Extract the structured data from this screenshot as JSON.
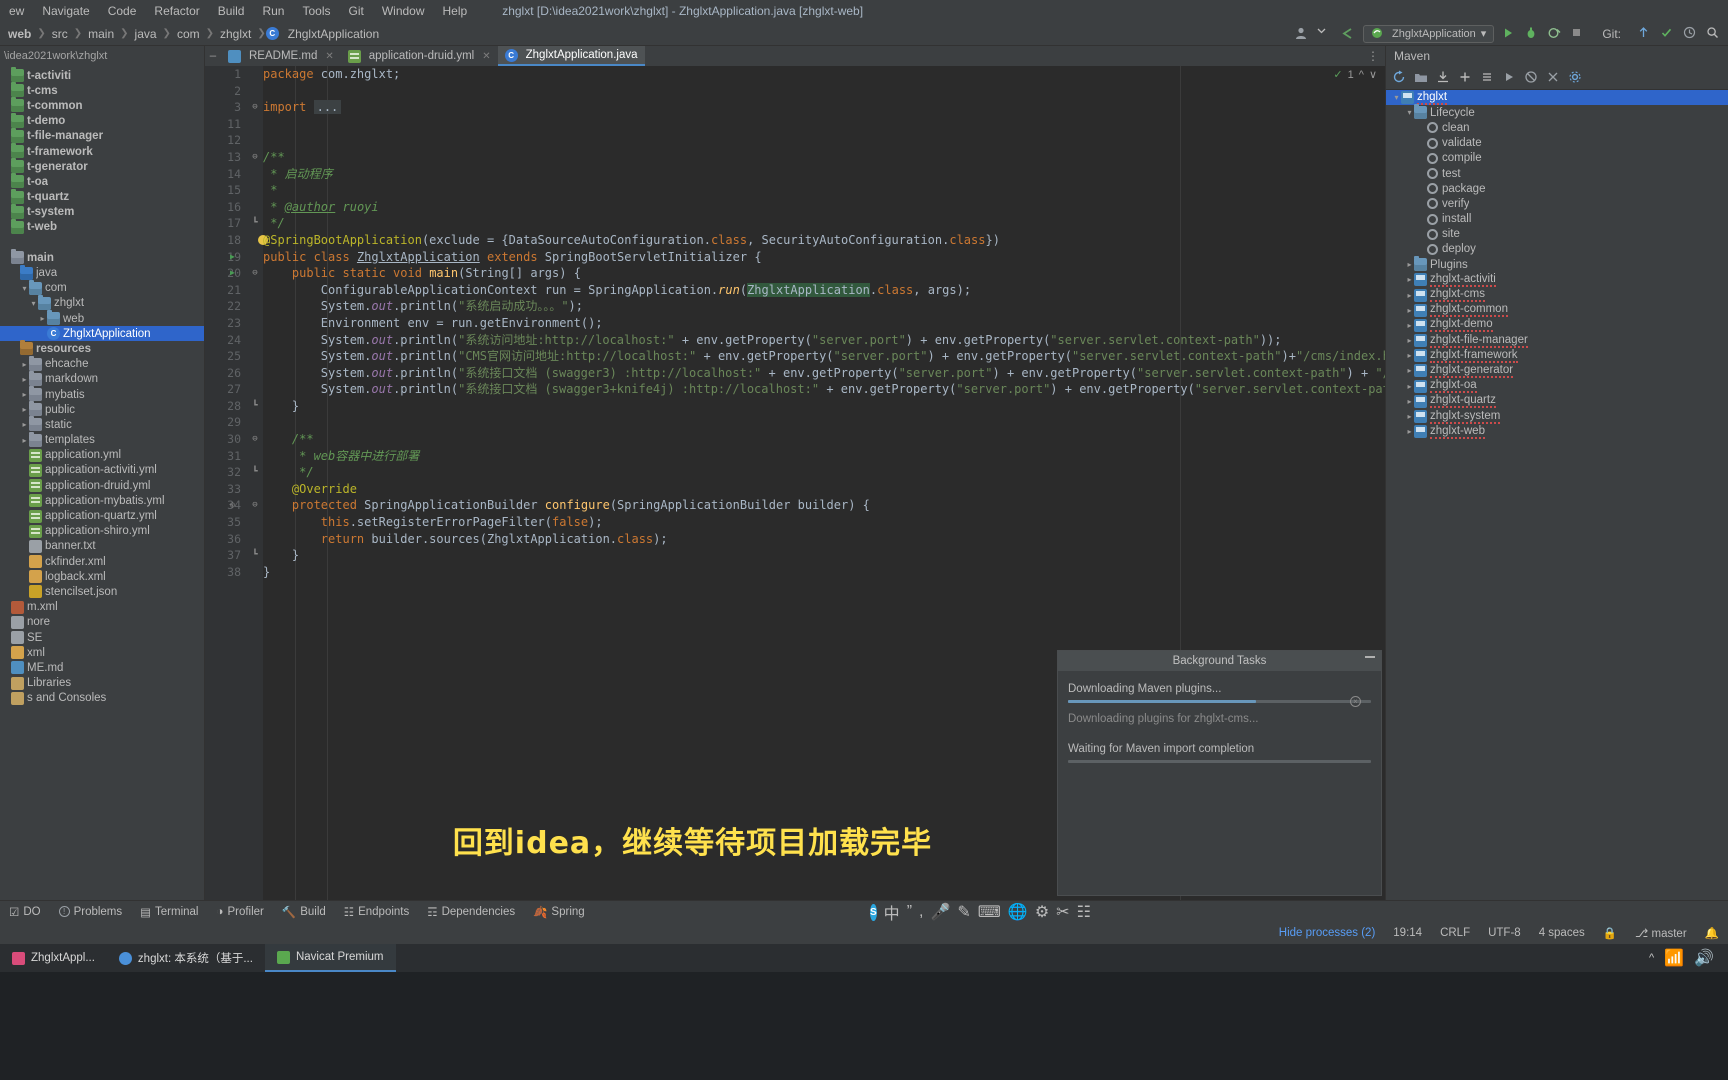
{
  "window": {
    "title": "zhglxt [D:\\idea2021work\\zhglxt] - ZhglxtApplication.java [zhglxt-web]",
    "menu": [
      "ew",
      "Navigate",
      "Code",
      "Refactor",
      "Build",
      "Run",
      "Tools",
      "Git",
      "Window",
      "Help"
    ]
  },
  "navbar": {
    "crumbs": [
      "web",
      "src",
      "main",
      "java",
      "com",
      "zhglxt",
      "ZhglxtApplication"
    ],
    "run_config": "ZhglxtApplication",
    "icons": [
      "user-avatar-icon",
      "chevron-down-icon",
      "back-arrow-icon",
      "run-icon",
      "debug-icon",
      "run-with-coverage-icon",
      "stop-icon",
      "search-icon"
    ],
    "git_label": "Git:"
  },
  "project_panel": {
    "header": "\\idea2021work\\zhglxt",
    "items": [
      {
        "label": "t-activiti",
        "indent": 0,
        "icon": "module-icon",
        "bold": true,
        "arrow": ""
      },
      {
        "label": "t-cms",
        "indent": 0,
        "icon": "module-icon",
        "bold": true,
        "arrow": ""
      },
      {
        "label": "t-common",
        "indent": 0,
        "icon": "module-icon",
        "bold": true,
        "arrow": ""
      },
      {
        "label": "t-demo",
        "indent": 0,
        "icon": "module-icon",
        "bold": true,
        "arrow": ""
      },
      {
        "label": "t-file-manager",
        "indent": 0,
        "icon": "module-icon",
        "bold": true,
        "arrow": ""
      },
      {
        "label": "t-framework",
        "indent": 0,
        "icon": "module-icon",
        "bold": true,
        "arrow": ""
      },
      {
        "label": "t-generator",
        "indent": 0,
        "icon": "module-icon",
        "bold": true,
        "arrow": ""
      },
      {
        "label": "t-oa",
        "indent": 0,
        "icon": "module-icon",
        "bold": true,
        "arrow": ""
      },
      {
        "label": "t-quartz",
        "indent": 0,
        "icon": "module-icon",
        "bold": true,
        "arrow": ""
      },
      {
        "label": "t-system",
        "indent": 0,
        "icon": "module-icon",
        "bold": true,
        "arrow": ""
      },
      {
        "label": "t-web",
        "indent": 0,
        "icon": "module-icon",
        "bold": true,
        "arrow": ""
      },
      {
        "label": "",
        "indent": 0,
        "icon": "spacer",
        "bold": false,
        "arrow": ""
      },
      {
        "label": "main",
        "indent": 0,
        "icon": "folder-icon",
        "bold": true,
        "arrow": ""
      },
      {
        "label": "java",
        "indent": 1,
        "icon": "source-folder-icon",
        "bold": false,
        "arrow": ""
      },
      {
        "label": "com",
        "indent": 2,
        "icon": "package-folder-icon",
        "bold": false,
        "arrow": "v"
      },
      {
        "label": "zhglxt",
        "indent": 3,
        "icon": "package-folder-icon",
        "bold": false,
        "arrow": "v"
      },
      {
        "label": "web",
        "indent": 4,
        "icon": "package-folder-icon",
        "bold": false,
        "arrow": ">"
      },
      {
        "label": "ZhglxtApplication",
        "indent": 4,
        "icon": "java-class-icon",
        "bold": false,
        "arrow": "",
        "selected": true
      },
      {
        "label": "resources",
        "indent": 1,
        "icon": "resource-folder-icon",
        "bold": true,
        "arrow": ""
      },
      {
        "label": "ehcache",
        "indent": 2,
        "icon": "folder-icon",
        "bold": false,
        "arrow": ">"
      },
      {
        "label": "markdown",
        "indent": 2,
        "icon": "folder-icon",
        "bold": false,
        "arrow": ">"
      },
      {
        "label": "mybatis",
        "indent": 2,
        "icon": "folder-icon",
        "bold": false,
        "arrow": ">"
      },
      {
        "label": "public",
        "indent": 2,
        "icon": "folder-icon",
        "bold": false,
        "arrow": ">"
      },
      {
        "label": "static",
        "indent": 2,
        "icon": "folder-icon",
        "bold": false,
        "arrow": ">"
      },
      {
        "label": "templates",
        "indent": 2,
        "icon": "folder-icon",
        "bold": false,
        "arrow": ">"
      },
      {
        "label": "application.yml",
        "indent": 2,
        "icon": "yml-file-icon",
        "bold": false,
        "arrow": ""
      },
      {
        "label": "application-activiti.yml",
        "indent": 2,
        "icon": "yml-file-icon",
        "bold": false,
        "arrow": ""
      },
      {
        "label": "application-druid.yml",
        "indent": 2,
        "icon": "yml-file-icon",
        "bold": false,
        "arrow": ""
      },
      {
        "label": "application-mybatis.yml",
        "indent": 2,
        "icon": "yml-file-icon",
        "bold": false,
        "arrow": ""
      },
      {
        "label": "application-quartz.yml",
        "indent": 2,
        "icon": "yml-file-icon",
        "bold": false,
        "arrow": ""
      },
      {
        "label": "application-shiro.yml",
        "indent": 2,
        "icon": "yml-file-icon",
        "bold": false,
        "arrow": ""
      },
      {
        "label": "banner.txt",
        "indent": 2,
        "icon": "txt-file-icon",
        "bold": false,
        "arrow": ""
      },
      {
        "label": "ckfinder.xml",
        "indent": 2,
        "icon": "xml-file-icon",
        "bold": false,
        "arrow": ""
      },
      {
        "label": "logback.xml",
        "indent": 2,
        "icon": "xml-file-icon",
        "bold": false,
        "arrow": ""
      },
      {
        "label": "stencilset.json",
        "indent": 2,
        "icon": "json-file-icon",
        "bold": false,
        "arrow": ""
      },
      {
        "label": "m.xml",
        "indent": 0,
        "icon": "maven-file-icon",
        "bold": false,
        "arrow": ""
      },
      {
        "label": "nore",
        "indent": 0,
        "icon": "txt-file-icon",
        "bold": false,
        "arrow": ""
      },
      {
        "label": "SE",
        "indent": 0,
        "icon": "txt-file-icon",
        "bold": false,
        "arrow": ""
      },
      {
        "label": "xml",
        "indent": 0,
        "icon": "xml-file-icon",
        "bold": false,
        "arrow": ""
      },
      {
        "label": "ME.md",
        "indent": 0,
        "icon": "markdown-file-icon",
        "bold": false,
        "arrow": ""
      },
      {
        "label": "Libraries",
        "indent": 0,
        "icon": "library-icon",
        "bold": false,
        "arrow": ""
      },
      {
        "label": "s and Consoles",
        "indent": 0,
        "icon": "library-icon",
        "bold": false,
        "arrow": ""
      }
    ]
  },
  "tabs": [
    {
      "label": "README.md",
      "icon": "markdown-file-icon",
      "active": false,
      "closable": true
    },
    {
      "label": "application-druid.yml",
      "icon": "yml-file-icon",
      "active": false,
      "closable": true
    },
    {
      "label": "ZhglxtApplication.java",
      "icon": "java-class-icon",
      "active": true,
      "closable": false
    }
  ],
  "editor": {
    "inspection_count": "1",
    "lines": [
      {
        "n": "1",
        "indent": 0,
        "html": "<span class='k'>package</span> com.zhglxt;"
      },
      {
        "n": "2",
        "indent": 0,
        "html": ""
      },
      {
        "n": "3",
        "indent": 0,
        "fold": "-",
        "html": "<span class='k'>import</span> <span class='folded'>...</span>"
      },
      {
        "n": "11",
        "indent": 0,
        "html": ""
      },
      {
        "n": "12",
        "indent": 0,
        "html": ""
      },
      {
        "n": "13",
        "indent": 0,
        "fold": "-",
        "html": "<span class='cm'>/**</span>"
      },
      {
        "n": "14",
        "indent": 0,
        "html": "<span class='cm'> * 启动程序</span>"
      },
      {
        "n": "15",
        "indent": 0,
        "html": "<span class='cm'> *</span>"
      },
      {
        "n": "16",
        "indent": 0,
        "html": "<span class='cm'> * <span class='ul'>@author</span> ruoyi</span>"
      },
      {
        "n": "17",
        "indent": 0,
        "fold": "^",
        "html": "<span class='cm'> */</span>"
      },
      {
        "n": "18",
        "indent": 0,
        "bulb": true,
        "html": "<span class='an'>@SpringBootApplication</span>(exclude = {DataSourceAutoConfiguration.<span class='k'>class</span>, SecurityAutoConfiguration.<span class='k'>class</span>})"
      },
      {
        "n": "19",
        "indent": 0,
        "run": true,
        "html": "<span class='k'>public class</span> <span class='ul'>ZhglxtApplication</span> <span class='k'>extends</span> SpringBootServletInitializer {"
      },
      {
        "n": "20",
        "indent": 0,
        "run": true,
        "fold": "-",
        "html": "    <span class='k'>public static void</span> <span class='fl'>main</span>(String[] args) {"
      },
      {
        "n": "21",
        "indent": 0,
        "html": "        ConfigurableApplicationContext run = SpringApplication.<span class='fl' style='font-style:italic'>run</span>(<span class='hl'>ZhglxtApplication</span>.<span class='k'>class</span>, args);"
      },
      {
        "n": "22",
        "indent": 0,
        "html": "        System.<span class='fld'>out</span>.println(<span class='s'>\"系统启动成功。。。\"</span>);"
      },
      {
        "n": "23",
        "indent": 0,
        "html": "        Environment env = run.getEnvironment();"
      },
      {
        "n": "24",
        "indent": 0,
        "html": "        System.<span class='fld'>out</span>.println(<span class='s'>\"系统访问地址:http://localhost:\"</span> + env.getProperty(<span class='s'>\"server.port\"</span>) + env.getProperty(<span class='s'>\"server.servlet.context-path\"</span>));"
      },
      {
        "n": "25",
        "indent": 0,
        "html": "        System.<span class='fld'>out</span>.println(<span class='s'>\"CMS官网访问地址:http://localhost:\"</span> + env.getProperty(<span class='s'>\"server.port\"</span>) + env.getProperty(<span class='s'>\"server.servlet.context-path\"</span>)+<span class='s'>\"/cms/index.html\"</span>);"
      },
      {
        "n": "26",
        "indent": 0,
        "html": "        System.<span class='fld'>out</span>.println(<span class='s'>\"系统接口文档 (swagger3) :http://localhost:\"</span> + env.getProperty(<span class='s'>\"server.port\"</span>) + env.getProperty(<span class='s'>\"server.servlet.context-path\"</span>) + <span class='s'>\"/swagger-ui/index.html（登录后访问）\"</span>);"
      },
      {
        "n": "27",
        "indent": 0,
        "html": "        System.<span class='fld'>out</span>.println(<span class='s'>\"系统接口文档 (swagger3+knife4j) :http://localhost:\"</span> + env.getProperty(<span class='s'>\"server.port\"</span>) + env.getProperty(<span class='s'>\"server.servlet.context-path\"</span>) + <span class='s'>\"/doc.html（登录后访问）\"</span>);"
      },
      {
        "n": "28",
        "indent": 0,
        "fold": "^",
        "html": "    }"
      },
      {
        "n": "29",
        "indent": 0,
        "html": ""
      },
      {
        "n": "30",
        "indent": 0,
        "fold": "-",
        "html": "    <span class='cm'>/**</span>"
      },
      {
        "n": "31",
        "indent": 0,
        "html": "     <span class='cm'>* web容器中进行部署</span>"
      },
      {
        "n": "32",
        "indent": 0,
        "fold": "^",
        "html": "     <span class='cm'>*/</span>"
      },
      {
        "n": "33",
        "indent": 0,
        "html": "    <span class='an'>@Override</span>"
      },
      {
        "n": "34",
        "indent": 0,
        "override": true,
        "fold": "-",
        "html": "    <span class='k'>protected</span> SpringApplicationBuilder <span class='fl'>configure</span>(SpringApplicationBuilder builder) {"
      },
      {
        "n": "35",
        "indent": 0,
        "html": "        <span class='k'>this</span>.setRegisterErrorPageFilter(<span class='k'>false</span>);"
      },
      {
        "n": "36",
        "indent": 0,
        "html": "        <span class='k'>return</span> builder.sources(ZhglxtApplication.<span class='k'>class</span>);"
      },
      {
        "n": "37",
        "indent": 0,
        "fold": "^",
        "html": "    }"
      },
      {
        "n": "38",
        "indent": 0,
        "html": "}"
      }
    ]
  },
  "maven_panel": {
    "title": "Maven",
    "toolbar_icons": [
      "refresh-icon",
      "add-maven-project-icon",
      "download-sources-icon",
      "add-icon",
      "collapse-all-icon",
      "run-maven-build-icon",
      "toggle-offline-icon",
      "skip-tests-icon",
      "settings-icon"
    ],
    "items": [
      {
        "label": "zhglxt",
        "indent": 0,
        "arrow": "v",
        "icon": "maven-project-icon",
        "selected": true
      },
      {
        "label": "Lifecycle",
        "indent": 1,
        "arrow": "v",
        "icon": "lifecycle-folder-icon"
      },
      {
        "label": "clean",
        "indent": 2,
        "arrow": "",
        "icon": "goal-icon"
      },
      {
        "label": "validate",
        "indent": 2,
        "arrow": "",
        "icon": "goal-icon"
      },
      {
        "label": "compile",
        "indent": 2,
        "arrow": "",
        "icon": "goal-icon"
      },
      {
        "label": "test",
        "indent": 2,
        "arrow": "",
        "icon": "goal-icon"
      },
      {
        "label": "package",
        "indent": 2,
        "arrow": "",
        "icon": "goal-icon"
      },
      {
        "label": "verify",
        "indent": 2,
        "arrow": "",
        "icon": "goal-icon"
      },
      {
        "label": "install",
        "indent": 2,
        "arrow": "",
        "icon": "goal-icon"
      },
      {
        "label": "site",
        "indent": 2,
        "arrow": "",
        "icon": "goal-icon"
      },
      {
        "label": "deploy",
        "indent": 2,
        "arrow": "",
        "icon": "goal-icon"
      },
      {
        "label": "Plugins",
        "indent": 1,
        "arrow": ">",
        "icon": "plugins-folder-icon"
      },
      {
        "label": "zhglxt-activiti",
        "indent": 1,
        "arrow": ">",
        "icon": "maven-module-icon"
      },
      {
        "label": "zhglxt-cms",
        "indent": 1,
        "arrow": ">",
        "icon": "maven-module-icon"
      },
      {
        "label": "zhglxt-common",
        "indent": 1,
        "arrow": ">",
        "icon": "maven-module-icon"
      },
      {
        "label": "zhglxt-demo",
        "indent": 1,
        "arrow": ">",
        "icon": "maven-module-icon"
      },
      {
        "label": "zhglxt-file-manager",
        "indent": 1,
        "arrow": ">",
        "icon": "maven-module-icon"
      },
      {
        "label": "zhglxt-framework",
        "indent": 1,
        "arrow": ">",
        "icon": "maven-module-icon"
      },
      {
        "label": "zhglxt-generator",
        "indent": 1,
        "arrow": ">",
        "icon": "maven-module-icon"
      },
      {
        "label": "zhglxt-oa",
        "indent": 1,
        "arrow": ">",
        "icon": "maven-module-icon"
      },
      {
        "label": "zhglxt-quartz",
        "indent": 1,
        "arrow": ">",
        "icon": "maven-module-icon"
      },
      {
        "label": "zhglxt-system",
        "indent": 1,
        "arrow": ">",
        "icon": "maven-module-icon"
      },
      {
        "label": "zhglxt-web",
        "indent": 1,
        "arrow": ">",
        "icon": "maven-module-icon"
      }
    ]
  },
  "background_tasks": {
    "title": "Background Tasks",
    "tasks": [
      {
        "label": "Downloading Maven plugins...",
        "progress": 62,
        "dim": false,
        "cancelable": true
      },
      {
        "label": "Downloading plugins for zhglxt-cms...",
        "progress": 0,
        "dim": true,
        "cancelable": false
      },
      {
        "label": "Waiting for Maven import completion",
        "progress": 0,
        "dim": false,
        "cancelable": false
      }
    ]
  },
  "subtitle": "回到idea，继续等待项目加载完毕",
  "bottom_tools": [
    {
      "label": "DO",
      "icon": "todo-icon"
    },
    {
      "label": "Problems",
      "icon": "problems-icon"
    },
    {
      "label": "Terminal",
      "icon": "terminal-icon"
    },
    {
      "label": "Profiler",
      "icon": "profiler-icon"
    },
    {
      "label": "Build",
      "icon": "build-icon"
    },
    {
      "label": "Endpoints",
      "icon": "endpoints-icon"
    },
    {
      "label": "Dependencies",
      "icon": "dependencies-icon"
    },
    {
      "label": "Spring",
      "icon": "spring-icon"
    }
  ],
  "status_bar": {
    "hide_processes": "Hide processes (2)",
    "time": "19:14",
    "line_sep": "CRLF",
    "encoding": "UTF-8",
    "indent": "4 spaces",
    "branch": "master",
    "icons": [
      "lock-icon",
      "branch-icon",
      "notifications-icon"
    ]
  },
  "ime_strip": {
    "items": [
      "skype-icon",
      "中",
      "quote-icon",
      "comma-icon",
      "mic-icon",
      "pen-icon",
      "keyboard-icon",
      "translate-icon",
      "settings-icon",
      "scissors-icon",
      "menu-icon"
    ]
  },
  "taskbar": {
    "items": [
      {
        "label": "ZhglxtAppl...",
        "icon": "idea-icon",
        "active": false,
        "color": "#d94c7a"
      },
      {
        "label": "zhglxt: 本系统（基于...",
        "icon": "browser-icon",
        "active": false,
        "color": "#4a90d9"
      },
      {
        "label": "Navicat Premium",
        "icon": "navicat-icon",
        "active": true,
        "color": "#5aa84f"
      }
    ],
    "tray": [
      "show-hidden-icons",
      "network-icon",
      "volume-icon"
    ]
  },
  "colors": {
    "accent": "#4a88c7",
    "selection": "#2f65ca",
    "editor_bg": "#2b2b2b",
    "panel_bg": "#3c3f41",
    "subtitle": "#ffe14d"
  }
}
